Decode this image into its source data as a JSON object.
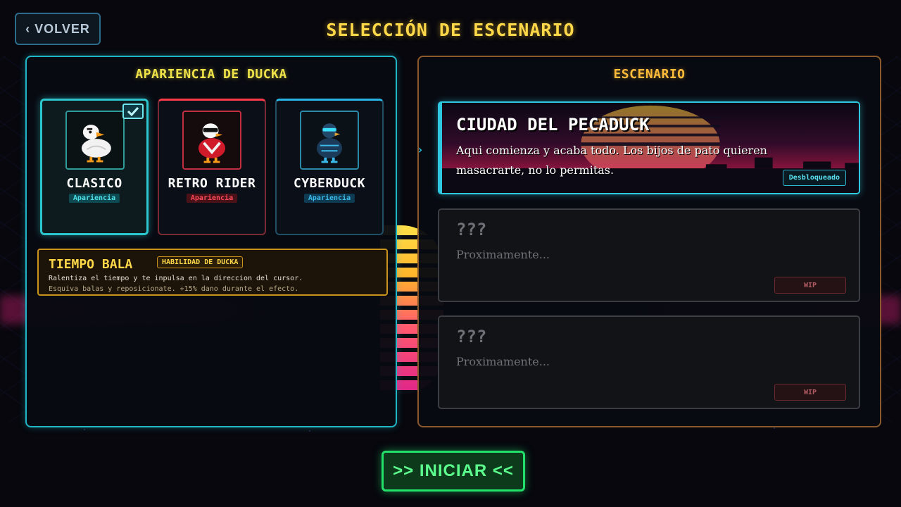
{
  "header": {
    "back_label": "‹ VOLVER",
    "title": "SELECCIÓN DE ESCENARIO"
  },
  "skins_panel": {
    "title": "APARIENCIA DE DUCKA",
    "cards": [
      {
        "name": "CLASICO",
        "tag": "Apariencia",
        "selected": true,
        "accent": "#2cc6cc"
      },
      {
        "name": "RETRO RIDER",
        "tag": "Apariencia",
        "selected": false,
        "accent": "#ff3b4a"
      },
      {
        "name": "CYBERDUCK",
        "tag": "Apariencia",
        "selected": false,
        "accent": "#2bb6e8"
      }
    ],
    "ability": {
      "name": "TIEMPO BALA",
      "badge": "HABILIDAD DE DUCKA",
      "line1": "Ralentiza el tiempo y te inpulsa en la direccion del cursor.",
      "line2": "Esquiva balas y reposicionate. +15% dano durante el efecto."
    }
  },
  "scenario_panel": {
    "title": "ESCENARIO",
    "indicator": "›",
    "scenarios": [
      {
        "title": "CIUDAD DEL PECADUCK",
        "description": "Aqui comienza y acaba todo. Los bijos de pato quieren masacrarte, no lo permitas.",
        "status": "Desbloqueado"
      },
      {
        "title": "???",
        "description": "Proximamente...",
        "status": "WIP"
      },
      {
        "title": "???",
        "description": "Proximamente...",
        "status": "WIP"
      }
    ]
  },
  "start_label": ">> INICIAR <<",
  "colors": {
    "cyan": "#20b6c8",
    "gold": "#ffd84a",
    "green": "#22e06a",
    "red": "#ff3b4a"
  }
}
